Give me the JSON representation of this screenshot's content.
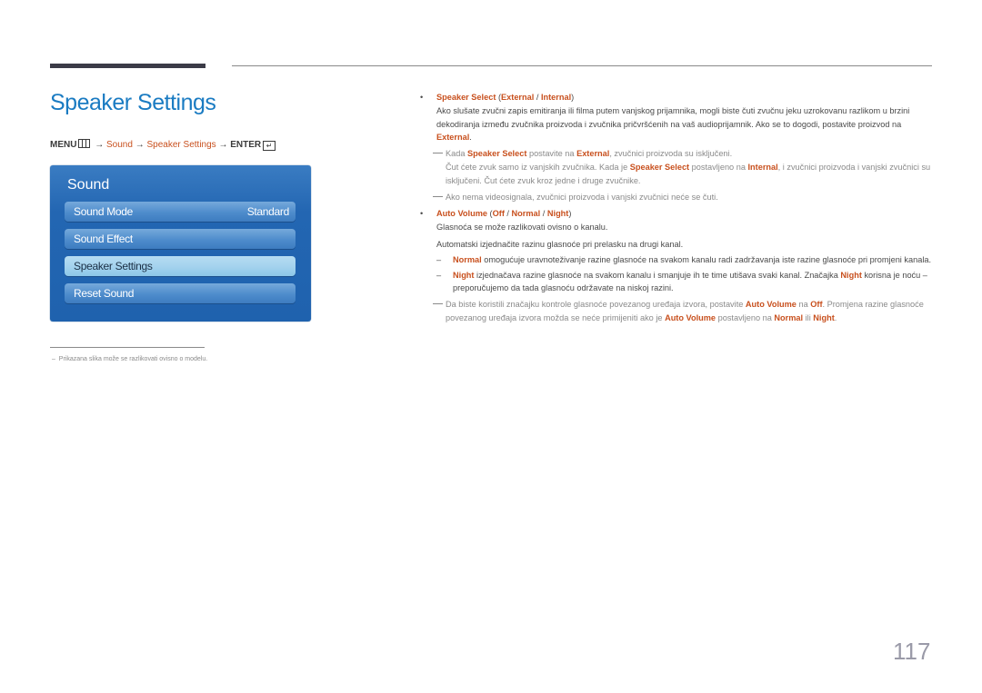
{
  "page": {
    "title": "Speaker Settings",
    "page_number": "117"
  },
  "breadcrumb": {
    "menu": "MENU",
    "menu_icon": "menu-icon",
    "arrow": "→",
    "step1": "Sound",
    "step2": "Speaker Settings",
    "enter": "ENTER",
    "enter_icon": "enter-icon"
  },
  "sound_menu": {
    "title": "Sound",
    "items": [
      {
        "label": "Sound Mode",
        "value": "Standard",
        "selected": false
      },
      {
        "label": "Sound Effect",
        "value": "",
        "selected": false
      },
      {
        "label": "Speaker Settings",
        "value": "",
        "selected": true
      },
      {
        "label": "Reset Sound",
        "value": "",
        "selected": false
      }
    ]
  },
  "footnote": "Prikazana slika može se razlikovati ovisno o modelu.",
  "sections": {
    "speaker_select": {
      "name": "Speaker Select",
      "opt1": "External",
      "opt2": "Internal",
      "desc_a": "Ako slušate zvučni zapis emitiranja ili filma putem vanjskog prijamnika, mogli biste čuti zvučnu jeku uzrokovanu razlikom u brzini dekodiranja između zvučnika proizvoda i zvučnika pričvršćenih na vaš audioprijamnik. Ako se to dogodi, postavite proizvod na ",
      "desc_b": "External",
      "desc_c": ".",
      "note1": {
        "t1": "Kada ",
        "k1": "Speaker Select",
        "t2": " postavite na ",
        "k2": "External",
        "t3": ", zvučnici proizvoda su isključeni.",
        "t4": "Čut ćete zvuk samo iz vanjskih zvučnika. Kada je ",
        "k3": "Speaker Select",
        "t5": " postavljeno na ",
        "k4": "Internal",
        "t6": ", i zvučnici proizvoda i vanjski zvučnici su isključeni. Čut ćete zvuk kroz jedne i druge zvučnike."
      },
      "note2": "Ako nema videosignala, zvučnici proizvoda i vanjski zvučnici neće se čuti."
    },
    "auto_volume": {
      "name": "Auto Volume",
      "opt1": "Off",
      "opt2": "Normal",
      "opt3": "Night",
      "desc1": "Glasnoća se može razlikovati ovisno o kanalu.",
      "desc2": "Automatski izjednačite razinu glasnoće pri prelasku na drugi kanal.",
      "dash1": {
        "k": "Normal",
        "t": " omogućuje uravnoteživanje razine glasnoće na svakom kanalu radi zadržavanja iste razine glasnoće pri promjeni kanala."
      },
      "dash2": {
        "k1": "Night",
        "t1": " izjednačava razine glasnoće na svakom kanalu i smanjuje ih te time utišava svaki kanal. Značajka ",
        "k2": "Night",
        "t2": " korisna je noću – preporučujemo da tada glasnoću održavate na niskoj razini."
      },
      "note": {
        "t1": "Da biste koristili značajku kontrole glasnoće povezanog uređaja izvora, postavite ",
        "k1": "Auto Volume",
        "t2": " na ",
        "k2": "Off",
        "t3": ". Promjena razine glasnoće povezanog uređaja izvora možda se neće primijeniti ako je ",
        "k3": "Auto Volume",
        "t4": " postavljeno na ",
        "k4": "Normal",
        "t5": " ili ",
        "k5": "Night",
        "t6": "."
      }
    }
  },
  "colors": {
    "title_blue": "#1a7bc2",
    "highlight_orange": "#c8501e",
    "panel_blue": "#2366b2",
    "selected_item": "#a5d3ee"
  }
}
